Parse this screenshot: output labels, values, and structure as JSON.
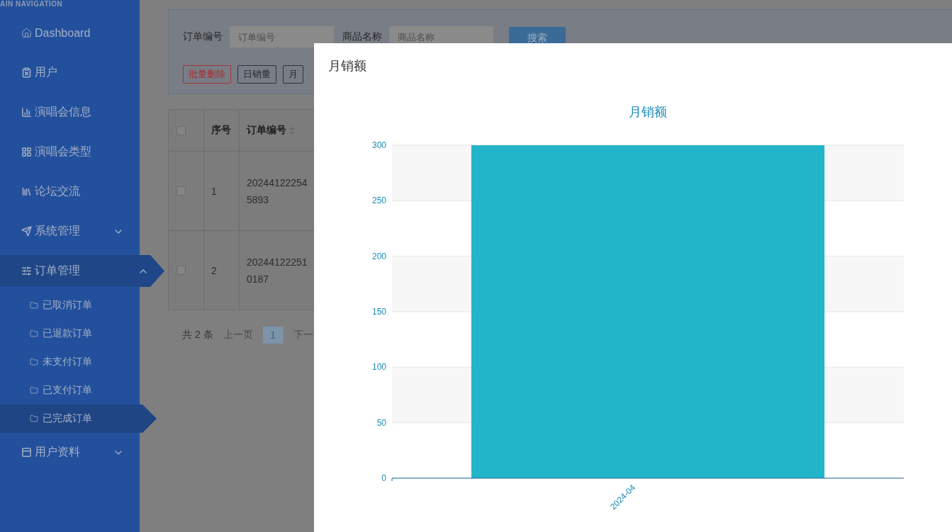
{
  "sidebar": {
    "heading": "AIN NAVIGATION",
    "items": [
      {
        "label": "Dashboard",
        "selected": false
      },
      {
        "label": "用户",
        "selected": false
      },
      {
        "label": "演唱会信息",
        "selected": false
      },
      {
        "label": "演唱会类型",
        "selected": false
      },
      {
        "label": "论坛交流",
        "selected": false
      },
      {
        "label": "系统管理",
        "selected": false,
        "expanded": false
      },
      {
        "label": "订单管理",
        "selected": true,
        "expanded": true,
        "children": [
          {
            "label": "已取消订单",
            "selected": false
          },
          {
            "label": "已退款订单",
            "selected": false
          },
          {
            "label": "未支付订单",
            "selected": false
          },
          {
            "label": "已支付订单",
            "selected": false
          },
          {
            "label": "已完成订单",
            "selected": true
          }
        ]
      },
      {
        "label": "用户资料",
        "selected": false,
        "expanded": false
      }
    ]
  },
  "filter": {
    "fields": [
      {
        "label": "订单编号",
        "placeholder": "订单编号"
      },
      {
        "label": "商品名称",
        "placeholder": "商品名称"
      }
    ],
    "search_button": "搜索",
    "actions": [
      {
        "label": "批量删除",
        "kind": "danger"
      },
      {
        "label": "日销量",
        "kind": "default"
      },
      {
        "label": "月",
        "kind": "default"
      }
    ]
  },
  "table": {
    "header_checked": false,
    "columns": [
      {
        "label": "序号",
        "sortable": false
      },
      {
        "label": "订单编号",
        "sortable": true
      }
    ],
    "rows": [
      {
        "checked": false,
        "index": "1",
        "order_no": "202441222545893"
      },
      {
        "checked": false,
        "index": "2",
        "order_no": "202441222510187"
      }
    ]
  },
  "pagination": {
    "total": "共 2 条",
    "prev": "上一页",
    "pages": [
      {
        "label": "1",
        "selected": true
      }
    ],
    "next": "下一"
  },
  "modal": {
    "title": "月销额",
    "chart_data": {
      "type": "bar",
      "title": "月销额",
      "categories": [
        "2024-04"
      ],
      "grid": true,
      "series": [
        {
          "color": "#22b5c9",
          "values": [
            300
          ]
        }
      ],
      "ylim": [
        0,
        300
      ],
      "yticks": [
        0,
        50,
        100,
        150,
        200,
        250,
        300
      ]
    }
  }
}
